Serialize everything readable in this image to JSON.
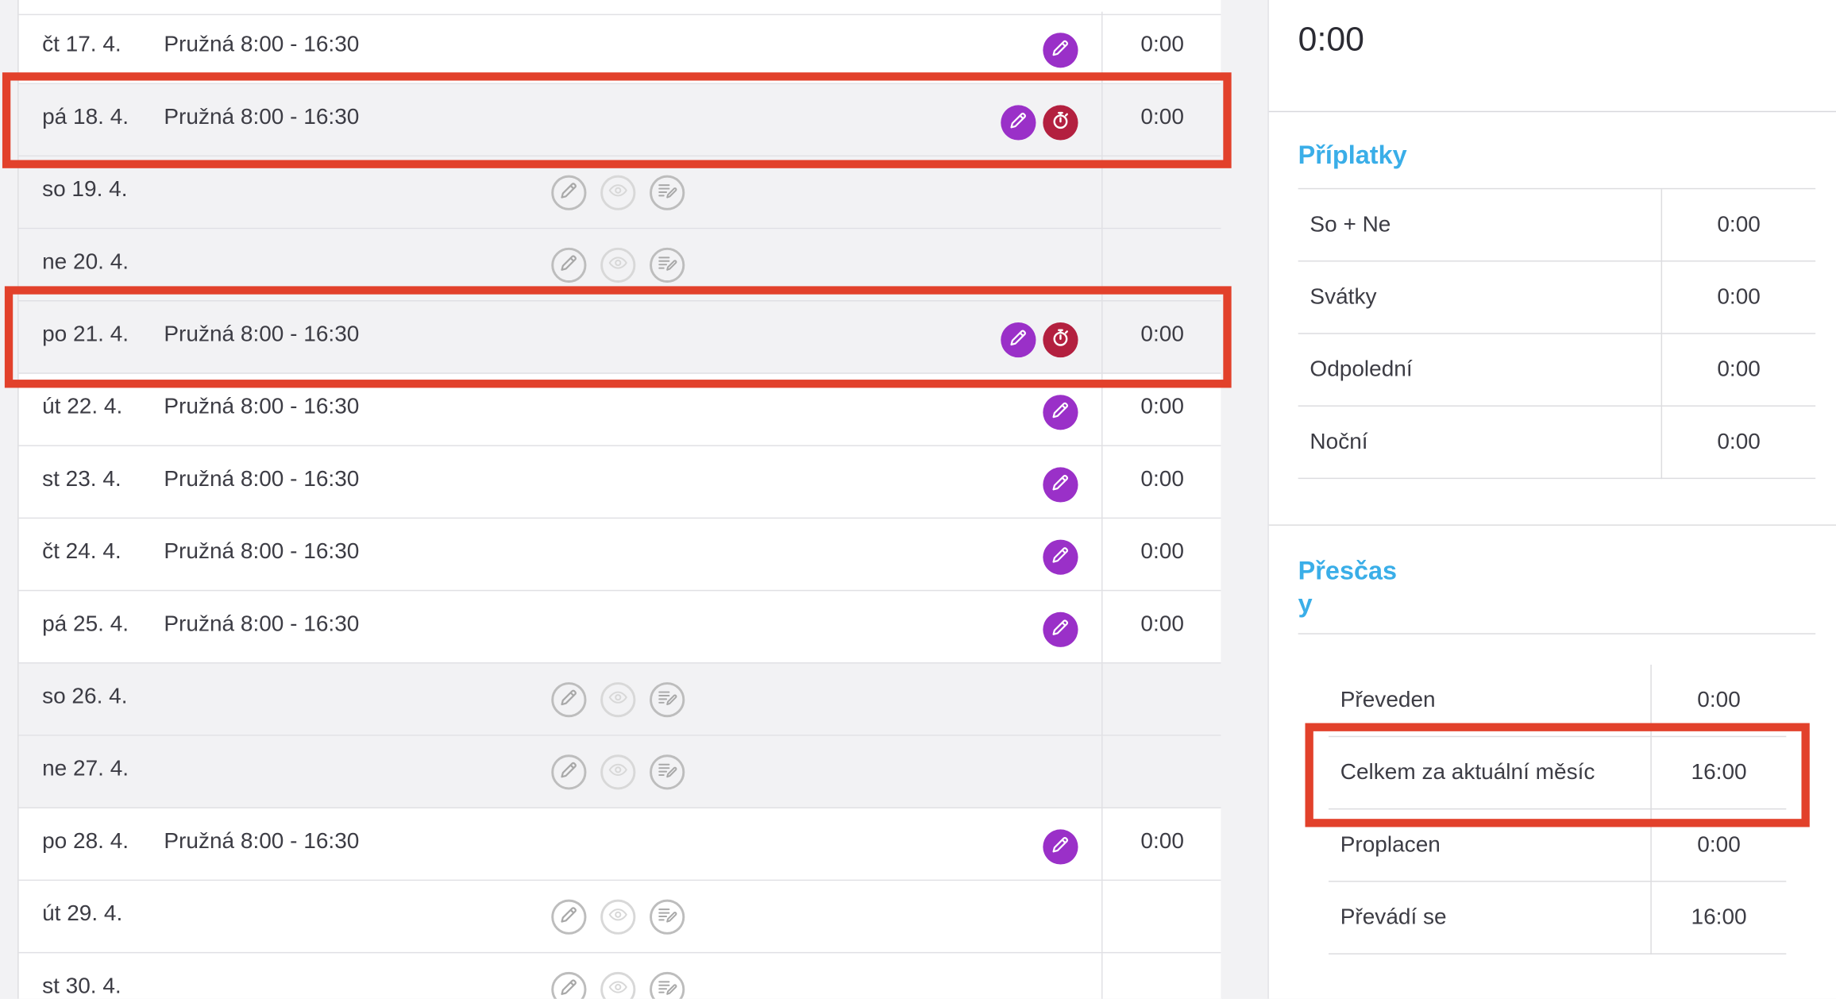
{
  "timesheet": {
    "rows": [
      {
        "date": "čt 17. 4.",
        "shift": "Pružná 8:00 - 16:30",
        "time": "0:00",
        "type": "work",
        "icons": [
          "edit"
        ]
      },
      {
        "date": "pá 18. 4.",
        "shift": "Pružná 8:00 - 16:30",
        "time": "0:00",
        "type": "highlighted",
        "icons": [
          "edit",
          "stopwatch"
        ]
      },
      {
        "date": "so 19. 4.",
        "shift": "",
        "time": "",
        "type": "weekend",
        "icons": [
          "edit",
          "view",
          "note"
        ]
      },
      {
        "date": "ne 20. 4.",
        "shift": "",
        "time": "",
        "type": "weekend",
        "icons": [
          "edit",
          "view",
          "note"
        ]
      },
      {
        "date": "po 21. 4.",
        "shift": "Pružná 8:00 - 16:30",
        "time": "0:00",
        "type": "highlighted",
        "icons": [
          "edit",
          "stopwatch"
        ]
      },
      {
        "date": "út 22. 4.",
        "shift": "Pružná 8:00 - 16:30",
        "time": "0:00",
        "type": "work",
        "icons": [
          "edit"
        ]
      },
      {
        "date": "st 23. 4.",
        "shift": "Pružná 8:00 - 16:30",
        "time": "0:00",
        "type": "work",
        "icons": [
          "edit"
        ]
      },
      {
        "date": "čt 24. 4.",
        "shift": "Pružná 8:00 - 16:30",
        "time": "0:00",
        "type": "work",
        "icons": [
          "edit"
        ]
      },
      {
        "date": "pá 25. 4.",
        "shift": "Pružná 8:00 - 16:30",
        "time": "0:00",
        "type": "work",
        "icons": [
          "edit"
        ]
      },
      {
        "date": "so 26. 4.",
        "shift": "",
        "time": "",
        "type": "weekend",
        "icons": [
          "edit",
          "view",
          "note"
        ]
      },
      {
        "date": "ne 27. 4.",
        "shift": "",
        "time": "",
        "type": "weekend",
        "icons": [
          "edit",
          "view",
          "note"
        ]
      },
      {
        "date": "po 28. 4.",
        "shift": "Pružná 8:00 - 16:30",
        "time": "0:00",
        "type": "work",
        "icons": [
          "edit"
        ]
      },
      {
        "date": "út 29. 4.",
        "shift": "",
        "time": "",
        "type": "weekday-empty",
        "icons": [
          "edit",
          "view",
          "note"
        ]
      },
      {
        "date": "st 30. 4.",
        "shift": "",
        "time": "",
        "type": "weekday-empty",
        "icons": [
          "edit",
          "view",
          "note"
        ]
      }
    ]
  },
  "summary": {
    "total_value": "0:00",
    "priplatky": {
      "title": "Příplatky",
      "rows": [
        {
          "label": "So + Ne",
          "value": "0:00"
        },
        {
          "label": "Svátky",
          "value": "0:00"
        },
        {
          "label": "Odpolední",
          "value": "0:00"
        },
        {
          "label": "Noční",
          "value": "0:00"
        }
      ]
    },
    "prescasy": {
      "title_line1": "Přesčas",
      "title_line2": "y",
      "rows": [
        {
          "label": "Převeden",
          "value": "0:00"
        },
        {
          "label": "Celkem za aktuální měsíc",
          "value": "16:00"
        },
        {
          "label": "Proplacen",
          "value": "0:00"
        },
        {
          "label": "Převádí se",
          "value": "16:00"
        }
      ]
    }
  },
  "colors": {
    "accent_purple": "#9a30c8",
    "accent_red": "#b3203f",
    "section_title": "#3aaee8",
    "highlight_box": "#e2412b"
  }
}
